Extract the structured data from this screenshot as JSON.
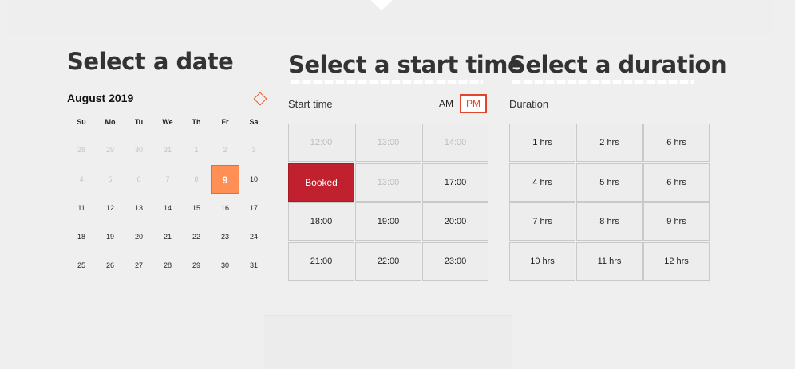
{
  "calendar": {
    "heading": "Select a date",
    "month": "August 2019",
    "next_icon": "chevron-right-diamond-icon",
    "weekdays": [
      "Su",
      "Mo",
      "Tu",
      "We",
      "Th",
      "Fr",
      "Sa"
    ],
    "rows": [
      [
        "28",
        "29",
        "30",
        "31",
        "1",
        "2",
        "3"
      ],
      [
        "4",
        "5",
        "6",
        "7",
        "8",
        "9",
        "10"
      ],
      [
        "11",
        "12",
        "13",
        "14",
        "15",
        "16",
        "17"
      ],
      [
        "18",
        "19",
        "20",
        "21",
        "22",
        "23",
        "24"
      ],
      [
        "25",
        "26",
        "27",
        "28",
        "29",
        "30",
        "31"
      ]
    ],
    "selected_day": "9",
    "selected_color": "#ff8f55"
  },
  "start_time": {
    "heading": "Select a start time",
    "label": "Start time",
    "am_label": "AM",
    "pm_label": "PM",
    "active_period": "PM",
    "accent": "#e2462a",
    "slots": [
      [
        "12:00",
        "13:00",
        "14:00"
      ],
      [
        "Booked",
        "13:00",
        "17:00"
      ],
      [
        "18:00",
        "19:00",
        "20:00"
      ],
      [
        "21:00",
        "22:00",
        "23:00"
      ]
    ],
    "booked_color": "#c1212f"
  },
  "duration": {
    "heading": "Select a duration",
    "label": "Duration",
    "options": [
      [
        "1 hrs",
        "2 hrs",
        "6 hrs"
      ],
      [
        "4 hrs",
        "5 hrs",
        "6 hrs"
      ],
      [
        "7 hrs",
        "8 hrs",
        "9 hrs"
      ],
      [
        "10 hrs",
        "11 hrs",
        "12 hrs"
      ]
    ]
  }
}
